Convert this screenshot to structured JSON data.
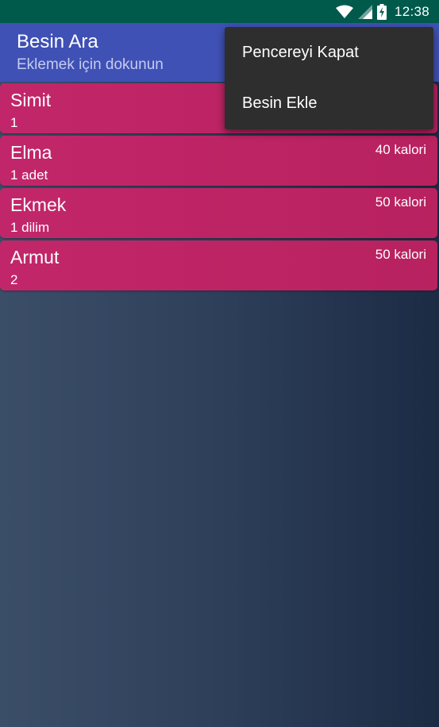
{
  "status_bar": {
    "time": "12:38",
    "icons": [
      "wifi-icon",
      "signal-icon",
      "battery-charging-icon"
    ]
  },
  "app_bar": {
    "title": "Besin Ara",
    "subtitle": "Eklemek için dokunun"
  },
  "foods": [
    {
      "name": "Simit",
      "quantity": "1",
      "calories": ""
    },
    {
      "name": "Elma",
      "quantity": "1 adet",
      "calories": "40 kalori"
    },
    {
      "name": "Ekmek",
      "quantity": "1 dilim",
      "calories": "50 kalori"
    },
    {
      "name": "Armut",
      "quantity": "2",
      "calories": "50 kalori"
    }
  ],
  "menu": {
    "items": [
      {
        "label": "Pencereyi Kapat"
      },
      {
        "label": "Besin Ekle"
      }
    ]
  },
  "colors": {
    "status_bar": "#005a4c",
    "app_bar": "#3f51b5",
    "card": "#c2266a",
    "menu": "#2e2e2e"
  }
}
